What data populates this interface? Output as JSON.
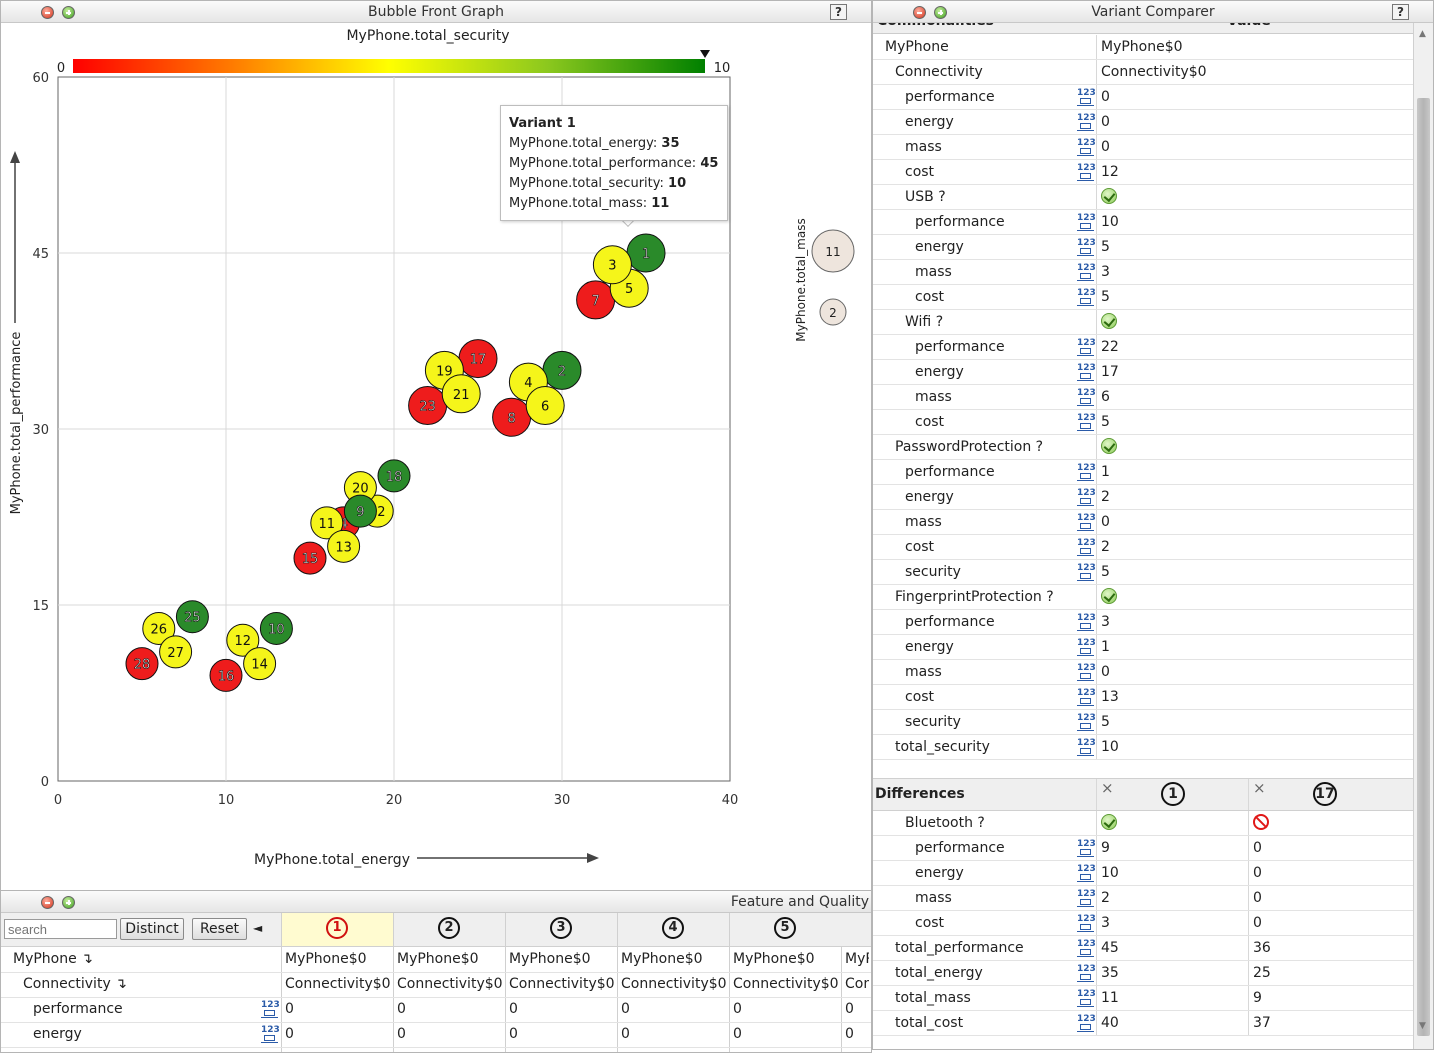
{
  "graph_panel": {
    "title": "Bubble Front Graph",
    "color_axis_label": "MyPhone.total_security",
    "color_min": "0",
    "color_max": "10",
    "x_axis_label": "MyPhone.total_energy",
    "y_axis_label": "MyPhone.total_performance",
    "size_legend_label": "MyPhone.total_mass",
    "size_legend_big": "11",
    "size_legend_small": "2",
    "colors": {
      "red": "#ee1c1c",
      "yellow": "#f5f51a",
      "green": "#2a8a2a"
    }
  },
  "tooltip": {
    "title": "Variant 1",
    "lines": [
      {
        "key": "MyPhone.total_energy:",
        "value": "35"
      },
      {
        "key": "MyPhone.total_performance:",
        "value": "45"
      },
      {
        "key": "MyPhone.total_security:",
        "value": "10"
      },
      {
        "key": "MyPhone.total_mass:",
        "value": "11"
      }
    ]
  },
  "chart_data": {
    "type": "scatter",
    "title": "",
    "xlabel": "MyPhone.total_energy",
    "ylabel": "MyPhone.total_performance",
    "colorlabel": "MyPhone.total_security",
    "xlim": [
      0,
      40
    ],
    "ylim": [
      0,
      60
    ],
    "xticks": [
      "0",
      "10",
      "20",
      "30",
      "40"
    ],
    "yticks": [
      "0",
      "15",
      "30",
      "45",
      "60"
    ],
    "grid": true,
    "points": [
      {
        "id": "28",
        "x": 5,
        "y": 10,
        "color": "red"
      },
      {
        "id": "26",
        "x": 6,
        "y": 13,
        "color": "yellow"
      },
      {
        "id": "27",
        "x": 7,
        "y": 11,
        "color": "yellow"
      },
      {
        "id": "25",
        "x": 8,
        "y": 14,
        "color": "green"
      },
      {
        "id": "16",
        "x": 10,
        "y": 9,
        "color": "red"
      },
      {
        "id": "12",
        "x": 11,
        "y": 12,
        "color": "yellow"
      },
      {
        "id": "14",
        "x": 12,
        "y": 10,
        "color": "yellow"
      },
      {
        "id": "10",
        "x": 13,
        "y": 13,
        "color": "green"
      },
      {
        "id": "15",
        "x": 15,
        "y": 19,
        "color": "red"
      },
      {
        "id": "4",
        "x": 17,
        "y": 22,
        "color": "red"
      },
      {
        "id": "11",
        "x": 16,
        "y": 22,
        "color": "yellow"
      },
      {
        "id": "13",
        "x": 17,
        "y": 20,
        "color": "yellow"
      },
      {
        "id": "22",
        "x": 19,
        "y": 23,
        "color": "yellow"
      },
      {
        "id": "20",
        "x": 18,
        "y": 25,
        "color": "yellow"
      },
      {
        "id": "9",
        "x": 18,
        "y": 23,
        "color": "green"
      },
      {
        "id": "18",
        "x": 20,
        "y": 26,
        "color": "green"
      },
      {
        "id": "23",
        "x": 22,
        "y": 32,
        "color": "red"
      },
      {
        "id": "17",
        "x": 25,
        "y": 36,
        "color": "red"
      },
      {
        "id": "19",
        "x": 23,
        "y": 35,
        "color": "yellow"
      },
      {
        "id": "21",
        "x": 24,
        "y": 33,
        "color": "yellow"
      },
      {
        "id": "8",
        "x": 27,
        "y": 31,
        "color": "red"
      },
      {
        "id": "2",
        "x": 30,
        "y": 35,
        "color": "green"
      },
      {
        "id": "4b",
        "label": "4",
        "x": 28,
        "y": 34,
        "color": "yellow"
      },
      {
        "id": "6",
        "x": 29,
        "y": 32,
        "color": "yellow"
      },
      {
        "id": "7",
        "x": 32,
        "y": 41,
        "color": "red"
      },
      {
        "id": "5",
        "x": 34,
        "y": 42,
        "color": "yellow"
      },
      {
        "id": "1",
        "x": 35,
        "y": 45,
        "color": "green"
      },
      {
        "id": "3",
        "x": 33,
        "y": 44,
        "color": "yellow"
      }
    ]
  },
  "comparer": {
    "title": "Variant Comparer",
    "header_left": "Commonalities",
    "header_right": "Value",
    "rows": [
      {
        "label": "MyPhone",
        "indent": 0,
        "icon": false,
        "value": "MyPhone$0"
      },
      {
        "label": "Connectivity",
        "indent": 1,
        "icon": false,
        "value": "Connectivity$0"
      },
      {
        "label": "performance",
        "indent": 2,
        "icon": true,
        "value": "0"
      },
      {
        "label": "energy",
        "indent": 2,
        "icon": true,
        "value": "0"
      },
      {
        "label": "mass",
        "indent": 2,
        "icon": true,
        "value": "0"
      },
      {
        "label": "cost",
        "indent": 2,
        "icon": true,
        "value": "12"
      },
      {
        "label": "USB ?",
        "indent": 2,
        "icon": false,
        "value": "",
        "check": true
      },
      {
        "label": "performance",
        "indent": 3,
        "icon": true,
        "value": "10"
      },
      {
        "label": "energy",
        "indent": 3,
        "icon": true,
        "value": "5"
      },
      {
        "label": "mass",
        "indent": 3,
        "icon": true,
        "value": "3"
      },
      {
        "label": "cost",
        "indent": 3,
        "icon": true,
        "value": "5"
      },
      {
        "label": "Wifi ?",
        "indent": 2,
        "icon": false,
        "value": "",
        "check": true
      },
      {
        "label": "performance",
        "indent": 3,
        "icon": true,
        "value": "22"
      },
      {
        "label": "energy",
        "indent": 3,
        "icon": true,
        "value": "17"
      },
      {
        "label": "mass",
        "indent": 3,
        "icon": true,
        "value": "6"
      },
      {
        "label": "cost",
        "indent": 3,
        "icon": true,
        "value": "5"
      },
      {
        "label": "PasswordProtection ?",
        "indent": 1,
        "icon": false,
        "value": "",
        "check": true
      },
      {
        "label": "performance",
        "indent": 2,
        "icon": true,
        "value": "1"
      },
      {
        "label": "energy",
        "indent": 2,
        "icon": true,
        "value": "2"
      },
      {
        "label": "mass",
        "indent": 2,
        "icon": true,
        "value": "0"
      },
      {
        "label": "cost",
        "indent": 2,
        "icon": true,
        "value": "2"
      },
      {
        "label": "security",
        "indent": 2,
        "icon": true,
        "value": "5"
      },
      {
        "label": "FingerprintProtection ?",
        "indent": 1,
        "icon": false,
        "value": "",
        "check": true
      },
      {
        "label": "performance",
        "indent": 2,
        "icon": true,
        "value": "3"
      },
      {
        "label": "energy",
        "indent": 2,
        "icon": true,
        "value": "1"
      },
      {
        "label": "mass",
        "indent": 2,
        "icon": true,
        "value": "0"
      },
      {
        "label": "cost",
        "indent": 2,
        "icon": true,
        "value": "13"
      },
      {
        "label": "security",
        "indent": 2,
        "icon": true,
        "value": "5"
      },
      {
        "label": "total_security",
        "indent": 1,
        "icon": true,
        "value": "10"
      }
    ],
    "differences_label": "Differences",
    "diff_col1": "1",
    "diff_col2": "17",
    "diff_close": "×",
    "diff_rows": [
      {
        "label": "Bluetooth ?",
        "indent": 2,
        "icon": false,
        "v1": "",
        "v2": "",
        "status": true
      },
      {
        "label": "performance",
        "indent": 3,
        "icon": true,
        "v1": "9",
        "v2": "0"
      },
      {
        "label": "energy",
        "indent": 3,
        "icon": true,
        "v1": "10",
        "v2": "0"
      },
      {
        "label": "mass",
        "indent": 3,
        "icon": true,
        "v1": "2",
        "v2": "0"
      },
      {
        "label": "cost",
        "indent": 3,
        "icon": true,
        "v1": "3",
        "v2": "0"
      },
      {
        "label": "total_performance",
        "indent": 1,
        "icon": true,
        "v1": "45",
        "v2": "36"
      },
      {
        "label": "total_energy",
        "indent": 1,
        "icon": true,
        "v1": "35",
        "v2": "25"
      },
      {
        "label": "total_mass",
        "indent": 1,
        "icon": true,
        "v1": "11",
        "v2": "9"
      },
      {
        "label": "total_cost",
        "indent": 1,
        "icon": true,
        "v1": "40",
        "v2": "37"
      }
    ]
  },
  "feature_panel": {
    "title": "Feature and Quality",
    "search_placeholder": "search",
    "distinct_label": "Distinct",
    "reset_label": "Reset",
    "collapse_arrow": "◄",
    "columns": [
      "1",
      "2",
      "3",
      "4",
      "5"
    ],
    "rows": [
      {
        "label": "MyPhone ↴",
        "indent": 0,
        "icon": false,
        "values": [
          "MyPhone$0",
          "MyPhone$0",
          "MyPhone$0",
          "MyPhone$0",
          "MyPhone$0",
          "MyP"
        ]
      },
      {
        "label": "Connectivity ↴",
        "indent": 1,
        "icon": false,
        "values": [
          "Connectivity$0",
          "Connectivity$0",
          "Connectivity$0",
          "Connectivity$0",
          "Connectivity$0",
          "Con"
        ]
      },
      {
        "label": "performance",
        "indent": 2,
        "icon": true,
        "values": [
          "0",
          "0",
          "0",
          "0",
          "0",
          "0"
        ]
      },
      {
        "label": "energy",
        "indent": 2,
        "icon": true,
        "values": [
          "0",
          "0",
          "0",
          "0",
          "0",
          "0"
        ]
      }
    ]
  }
}
